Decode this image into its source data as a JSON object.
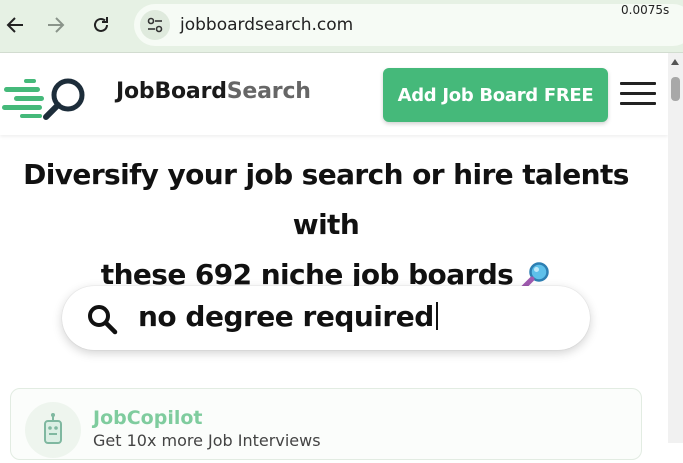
{
  "browser": {
    "url": "jobboardsearch.com",
    "icons": [
      "back-arrow-icon",
      "forward-arrow-icon",
      "reload-icon",
      "site-info-icon"
    ]
  },
  "header": {
    "brand_main": "JobBoard",
    "brand_accent": "Search",
    "add_button": "Add Job Board FREE",
    "timer": "0.0075s",
    "colors": {
      "accent": "#45b97a",
      "brand_gray": "#666666"
    }
  },
  "hero": {
    "line1": "Diversify your job search or hire talents with",
    "line2": "these 692 niche job boards",
    "emoji": "magnifying-glass-icon"
  },
  "search": {
    "value": "no degree required"
  },
  "results": [
    {
      "title": "JobCopilot",
      "subtitle": "Get 10x more Job Interviews"
    }
  ]
}
